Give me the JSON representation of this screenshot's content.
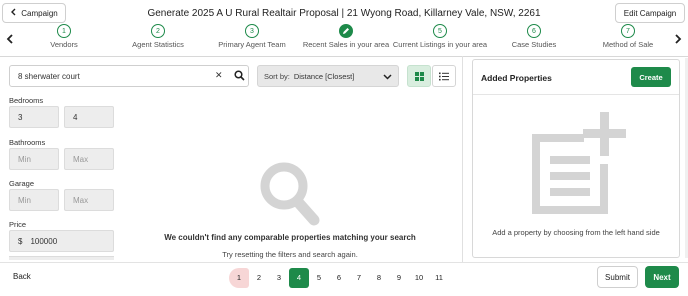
{
  "header": {
    "back_label": "Campaign",
    "title": "Generate 2025 A U Rural Realtair Proposal | 21 Wyong Road, Killarney Vale, NSW, 2261",
    "edit_label": "Edit Campaign"
  },
  "steps": [
    {
      "number": "1",
      "label": "Vendors"
    },
    {
      "number": "2",
      "label": "Agent Statistics"
    },
    {
      "number": "3",
      "label": "Primary Agent Team"
    },
    {
      "number": "",
      "label": "Recent Sales in your area",
      "icon": "pencil-icon",
      "active": true
    },
    {
      "number": "5",
      "label": "Current Listings in your area"
    },
    {
      "number": "6",
      "label": "Case Studies"
    },
    {
      "number": "7",
      "label": "Method of Sale"
    }
  ],
  "search": {
    "value": "8 sherwater court",
    "sort_label": "Sort by:",
    "sort_value": "Distance [Closest]"
  },
  "filters": {
    "bedrooms": {
      "label": "Bedrooms",
      "min": "3",
      "max": "4"
    },
    "bathrooms": {
      "label": "Bathrooms",
      "min_placeholder": "Min",
      "max_placeholder": "Max"
    },
    "garage": {
      "label": "Garage",
      "min_placeholder": "Min",
      "max_placeholder": "Max"
    },
    "price": {
      "label": "Price",
      "currency": "$",
      "value": "100000"
    }
  },
  "empty_state": {
    "title": "We couldn't find any comparable properties matching your search",
    "subtitle": "Try resetting the filters and search again."
  },
  "added_properties": {
    "title": "Added Properties",
    "create_label": "Create",
    "hint": "Add a property by choosing from the left hand side"
  },
  "footer": {
    "back_label": "Back",
    "pages": [
      "1",
      "2",
      "3",
      "4",
      "5",
      "6",
      "7",
      "8",
      "9",
      "10",
      "11"
    ],
    "current_page": "4",
    "submit_label": "Submit",
    "next_label": "Next"
  },
  "colors": {
    "accent": "#1e8a4a",
    "visited_page": "#f7d6d6"
  }
}
